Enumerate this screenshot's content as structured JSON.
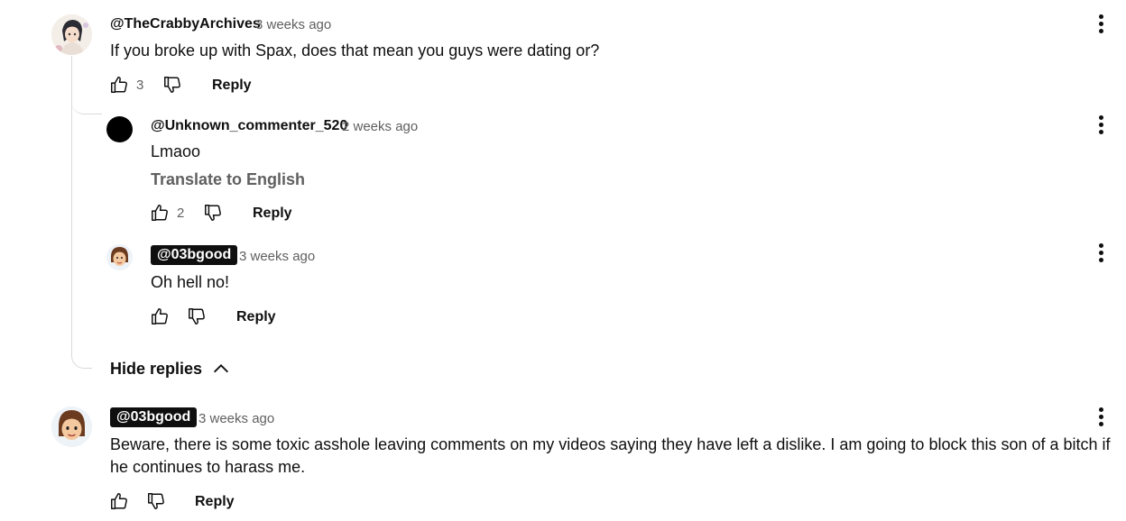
{
  "comments": [
    {
      "author": "@TheCrabbyArchives",
      "time": "3 weeks ago",
      "text": "If you broke up with Spax, does that mean you guys were dating or?",
      "likes": "3",
      "reply_label": "Reply",
      "avatar_icon": "anime-character-avatar"
    },
    {
      "author": "@Unknown_commenter_520",
      "time": "2 weeks ago",
      "text": "Lmaoo",
      "translate_label": "Translate to English",
      "likes": "2",
      "reply_label": "Reply",
      "avatar_color": "#000000"
    },
    {
      "author": "@03bgood",
      "time": "3 weeks ago",
      "text": "Oh hell no!",
      "reply_label": "Reply",
      "avatar_icon": "mii-avatar"
    },
    {
      "author": "@03bgood",
      "time": "3 weeks ago",
      "text": "Beware, there is some toxic asshole leaving comments on my videos saying they have left a dislike. I am going to block this son of a bitch if he continues to harass me.",
      "reply_label": "Reply",
      "avatar_icon": "mii-avatar"
    }
  ],
  "hide_replies_label": "Hide replies"
}
